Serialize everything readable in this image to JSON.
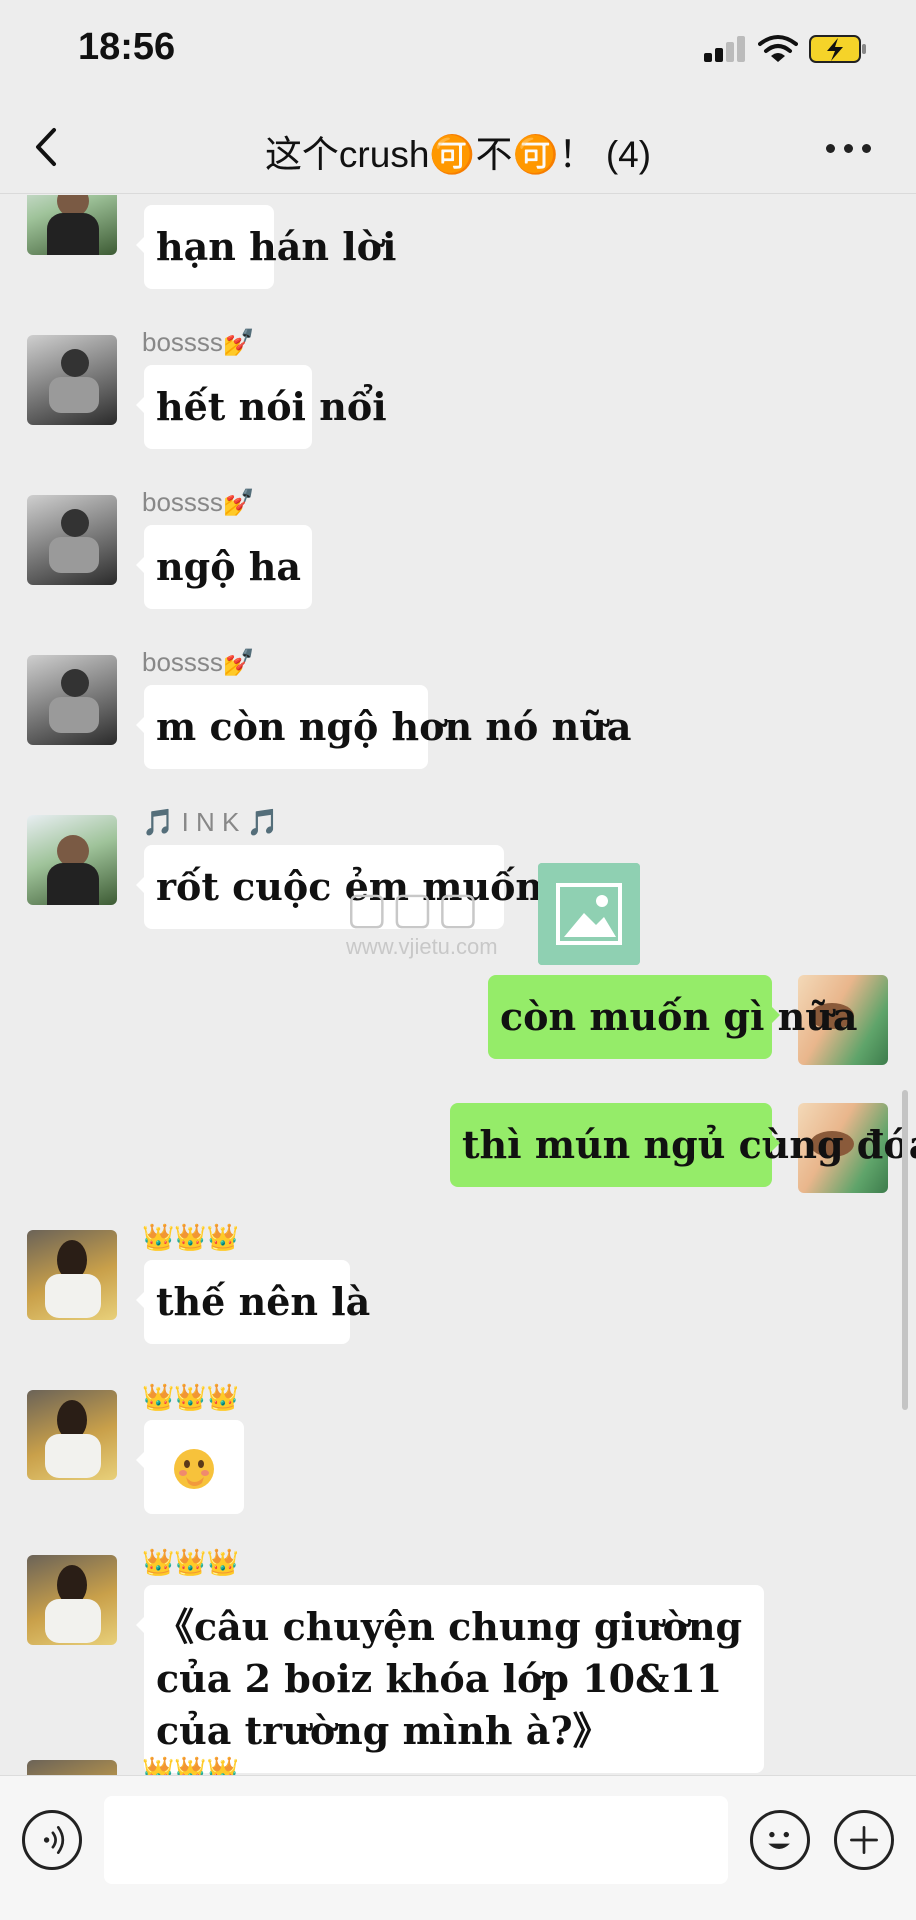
{
  "status_bar": {
    "time": "18:56"
  },
  "nav": {
    "title": "这个crush🉑不🉑！ (4)"
  },
  "messages": [
    {
      "side": "them",
      "sender": "",
      "text": "hạn hán lời"
    },
    {
      "side": "them",
      "sender": "bossss💅",
      "text": "hết nói nổi"
    },
    {
      "side": "them",
      "sender": "bossss💅",
      "text": "ngộ ha"
    },
    {
      "side": "them",
      "sender": "bossss💅",
      "text": "m còn ngộ hơn nó nữa"
    },
    {
      "side": "them",
      "sender": "🎵 I N K 🎵",
      "text": "rốt cuộc ẻm muốn gì"
    },
    {
      "side": "me",
      "sender": "",
      "text": "còn muốn gì nữa"
    },
    {
      "side": "me",
      "sender": "",
      "text": "thì mún ngủ cùng đóa"
    },
    {
      "side": "them",
      "sender": "👑👑👑",
      "text": "thế nên là"
    },
    {
      "side": "them",
      "sender": "👑👑👑",
      "text": ""
    },
    {
      "side": "them",
      "sender": "👑👑👑",
      "text": "《câu chuyện chung giường của 2 boiz khóa lớp 10&11 của trường mình à?》"
    },
    {
      "side": "them",
      "sender": "👑👑👑",
      "text": ""
    }
  ],
  "watermark": {
    "url": "www.vjietu.com"
  },
  "input": {
    "placeholder": "",
    "value": ""
  },
  "colors": {
    "background": "#ededed",
    "bubble_self": "#95ec69",
    "bubble_other": "#ffffff"
  }
}
